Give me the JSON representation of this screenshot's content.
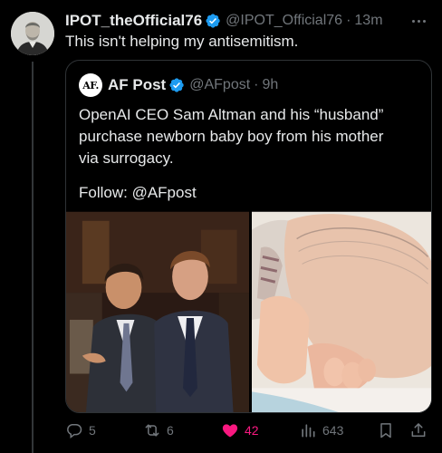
{
  "tweet": {
    "display_name": "IPOT_theOfficial76",
    "handle": "@IPOT_Official76",
    "separator": "·",
    "time": "13m",
    "text": "This isn't helping my antisemitism."
  },
  "quote": {
    "avatar_text": "AF.",
    "display_name": "AF Post",
    "handle": "@AFpost",
    "separator": "·",
    "time": "9h",
    "text_lines": [
      "OpenAI CEO Sam Altman and his “husband”",
      "purchase newborn baby boy from his mother",
      "via surrogacy."
    ],
    "follow": "Follow: @AFpost"
  },
  "actions": {
    "replies": "5",
    "reposts": "6",
    "likes": "42",
    "views": "643"
  },
  "colors": {
    "background": "#000000",
    "text": "#e7e9ea",
    "muted": "#71767b",
    "verified": "#1d9bf0",
    "like": "#f91880",
    "border": "#2f3336"
  },
  "icons": [
    "verified-badge-icon",
    "more-icon",
    "reply-icon",
    "repost-icon",
    "heart-icon",
    "views-icon",
    "bookmark-icon",
    "share-icon"
  ]
}
